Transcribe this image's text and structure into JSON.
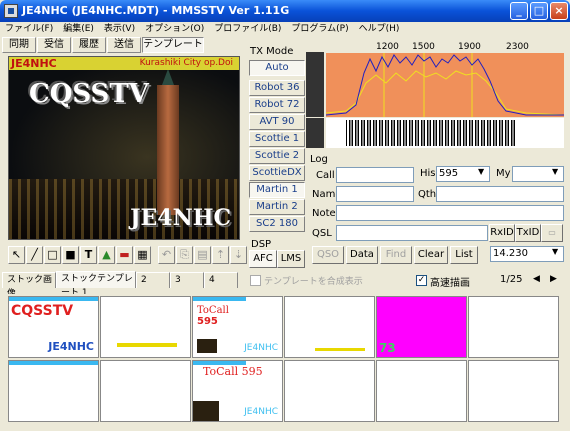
{
  "window": {
    "title": "JE4NHC (JE4NHC.MDT) - MMSSTV Ver 1.11G",
    "min": "_",
    "max": "□",
    "close": "×"
  },
  "menu": [
    "ファイル(F)",
    "編集(E)",
    "表示(V)",
    "オプション(O)",
    "プロファイル(B)",
    "プログラム(P)",
    "ヘルプ(H)"
  ],
  "mode_tabs": [
    "同期",
    "受信",
    "履歴",
    "送信",
    "テンプレート"
  ],
  "picture": {
    "callsign_top": "JE4NHC",
    "location": "Kurashiki City  op.Doi",
    "cq": "CQSSTV",
    "callsign_bottom": "JE4NHC"
  },
  "tx_mode": {
    "label": "TX Mode",
    "modes": [
      "Auto",
      "Robot 36",
      "Robot 72",
      "AVT 90",
      "Scottie 1",
      "Scottie 2",
      "ScottieDX",
      "Martin 1",
      "Martin 2",
      "SC2 180"
    ],
    "selected": "Auto"
  },
  "dsp": {
    "label": "DSP",
    "afc": "AFC",
    "lms": "LMS"
  },
  "spectrum": {
    "ticks": [
      "1200",
      "1500",
      "1900",
      "2300"
    ]
  },
  "log": {
    "label": "Log",
    "call_label": "Call",
    "his_label": "His",
    "his_value": "595",
    "my_label": "My",
    "my_value": "",
    "name_label": "Name",
    "qth_label": "Qth",
    "note_label": "Note",
    "qsl_label": "QSL",
    "rxid": "RxID",
    "txid": "TxID",
    "call_value": "",
    "name_value": "",
    "qth_value": "",
    "note_value": "",
    "qsl_value": ""
  },
  "buttons": {
    "qso": "QSO",
    "data": "Data",
    "find": "Find",
    "clear": "Clear",
    "list": "List",
    "freq": "14.230"
  },
  "options": {
    "template_compose": "テンプレートを合成表示",
    "fast_draw": "高速描画",
    "fast_draw_checked": true,
    "page": "1/25"
  },
  "bottom_tabs": [
    "ストック画像",
    "ストックテンプレート 1",
    "2",
    "3",
    "4"
  ],
  "stock_cells": [
    {
      "text1": "CQSSTV",
      "text2": "JE4NHC",
      "bg": "#ffffff"
    },
    {
      "text1": "",
      "text2": "",
      "bg": "#ffffff"
    },
    {
      "text1": "ToCall",
      "text2": "595",
      "text3": "JE4NHC",
      "bg": "#ffffff"
    },
    {
      "text1": "",
      "text2": "",
      "bg": "#ffffff"
    },
    {
      "text1": "73",
      "text2": "",
      "bg": "#ff00ff"
    },
    {
      "text1": "",
      "text2": "",
      "bg": "#ffffff"
    },
    {
      "text1": "",
      "text2": "",
      "bg": "#ffffff"
    },
    {
      "text1": "",
      "text2": "",
      "bg": "#ffffff"
    },
    {
      "text1": "ToCall  595",
      "text2": "JE4NHC",
      "bg": "#ffffff"
    },
    {
      "text1": "",
      "text2": "",
      "bg": "#ffffff"
    },
    {
      "text1": "",
      "text2": "",
      "bg": "#ffffff"
    },
    {
      "text1": "",
      "text2": "",
      "bg": "#ffffff"
    }
  ],
  "colors": {
    "title_bar": "#0a52d8",
    "spectrum_bg": "#f0905a",
    "spectrum_line": "#2020c0",
    "spectrum_peak": "#f0e020",
    "cq_red": "#e02020",
    "magenta": "#ff00ff"
  }
}
